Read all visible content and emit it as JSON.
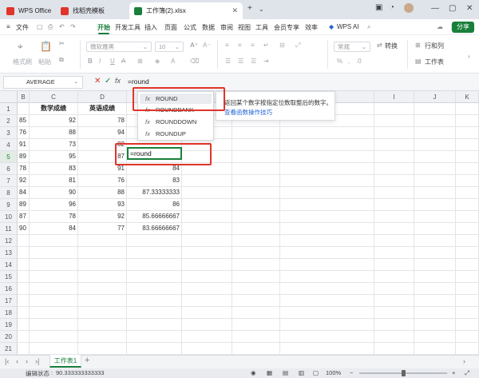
{
  "tabs": [
    {
      "label": "WPS Office",
      "color": "#e0342a"
    },
    {
      "label": "找稻壳模板",
      "color": "#e0342a"
    },
    {
      "label": "工作簿(2).xlsx",
      "color": "#1a7f3b"
    }
  ],
  "menu": {
    "file": "文件",
    "items": [
      "开始",
      "开发工具",
      "插入",
      "页面",
      "公式",
      "数据",
      "审阅",
      "视图",
      "工具",
      "会员专享",
      "效率"
    ],
    "active": "开始",
    "ai": "WPS AI",
    "share": "分享"
  },
  "ribbon": {
    "format_painter": "格式刷",
    "paste": "粘贴",
    "font_name": "微软雅黑",
    "font_size": "10",
    "number_format": "常规",
    "convert": "转换",
    "rows_cols": "行和列",
    "worksheet": "工作表"
  },
  "formula_bar": {
    "name_box": "AVERAGE",
    "content": "=round"
  },
  "columns": [
    "B",
    "C",
    "D",
    "E",
    "F",
    "G",
    "H",
    "I",
    "J",
    "K"
  ],
  "rows": [
    "1",
    "2",
    "3",
    "4",
    "5",
    "6",
    "7",
    "8",
    "9",
    "10",
    "11",
    "12",
    "13",
    "14",
    "15",
    "16",
    "17",
    "18",
    "19",
    "20",
    "21"
  ],
  "selected_row": "5",
  "headers": {
    "c": "数学成绩",
    "d": "英语成绩"
  },
  "data": [
    {
      "b": "85",
      "c": "92",
      "d": "78",
      "e": ""
    },
    {
      "b": "76",
      "c": "88",
      "d": "94",
      "e": ""
    },
    {
      "b": "91",
      "c": "73",
      "d": "82",
      "e": ""
    },
    {
      "b": "89",
      "c": "95",
      "d": "87",
      "e": "=round"
    },
    {
      "b": "78",
      "c": "83",
      "d": "91",
      "e": "84"
    },
    {
      "b": "92",
      "c": "81",
      "d": "76",
      "e": "83"
    },
    {
      "b": "84",
      "c": "90",
      "d": "88",
      "e": "87.33333333"
    },
    {
      "b": "89",
      "c": "96",
      "d": "93",
      "e": "86"
    },
    {
      "b": "87",
      "c": "78",
      "d": "92",
      "e": "85.66666667"
    },
    {
      "b": "90",
      "c": "84",
      "d": "77",
      "e": "83.66666667"
    }
  ],
  "autocomplete": {
    "items": [
      "ROUND",
      "ROUNDBANK",
      "ROUNDDOWN",
      "ROUNDUP"
    ],
    "selected": "ROUND",
    "tooltip": "返回某个数字按指定位数取整后的数字。",
    "tooltip_link": "查看函数操作技巧"
  },
  "sheet": {
    "tab": "工作表1",
    "add": "+"
  },
  "status": {
    "label": "编辑状态",
    "value": "90.333333333333",
    "zoom": "100%"
  }
}
